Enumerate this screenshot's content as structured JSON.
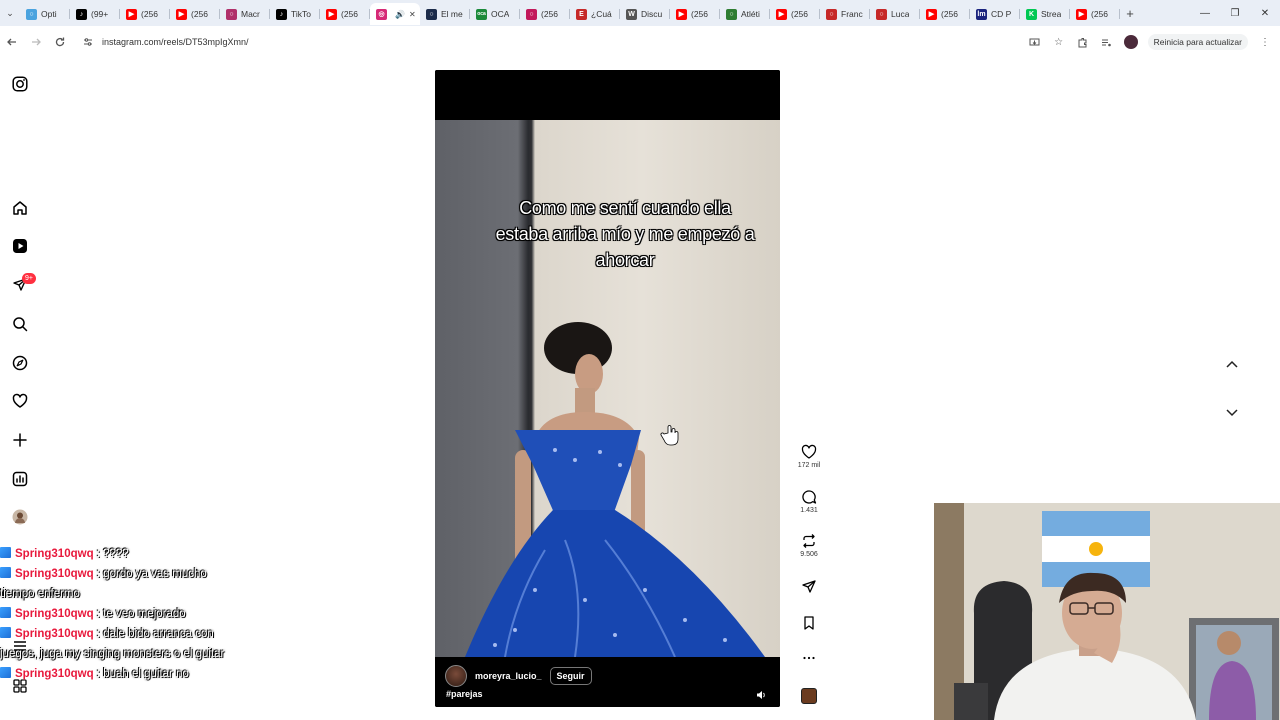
{
  "browser": {
    "tabs": [
      {
        "title": "Opti",
        "color": "#4aa3df",
        "icon": "circle-o"
      },
      {
        "title": "(99+",
        "color": "#000000",
        "icon": "tiktok"
      },
      {
        "title": "(256",
        "color": "#ff0000",
        "icon": "youtube"
      },
      {
        "title": "(256",
        "color": "#ff0000",
        "icon": "youtube"
      },
      {
        "title": "Macr",
        "color": "#b0306a",
        "icon": "circle"
      },
      {
        "title": "TikTo",
        "color": "#000000",
        "icon": "tiktok"
      },
      {
        "title": "(256",
        "color": "#ff0000",
        "icon": "youtube"
      },
      {
        "title": "",
        "color": "#d62976",
        "icon": "instagram",
        "active": true
      },
      {
        "title": "El me",
        "color": "#1c2b4a",
        "icon": "shield"
      },
      {
        "title": "OCA",
        "color": "#1b8a3a",
        "icon": "oca"
      },
      {
        "title": "(256",
        "color": "#c2185b",
        "icon": "circle"
      },
      {
        "title": "¿Cuá",
        "color": "#c62828",
        "icon": "E"
      },
      {
        "title": "Discu",
        "color": "#555555",
        "icon": "W"
      },
      {
        "title": "(256",
        "color": "#ff0000",
        "icon": "youtube"
      },
      {
        "title": "Atléti",
        "color": "#2e7d32",
        "icon": "circle-o"
      },
      {
        "title": "(256",
        "color": "#ff0000",
        "icon": "youtube"
      },
      {
        "title": "Franc",
        "color": "#c62828",
        "icon": "circle"
      },
      {
        "title": "Luca",
        "color": "#c62828",
        "icon": "circle"
      },
      {
        "title": "(256",
        "color": "#ff0000",
        "icon": "youtube"
      },
      {
        "title": "CD P",
        "color": "#1a237e",
        "icon": "lm"
      },
      {
        "title": "Strea",
        "color": "#00c853",
        "icon": "K"
      },
      {
        "title": "(256",
        "color": "#ff0000",
        "icon": "youtube"
      }
    ],
    "url": "instagram.com/reels/DT53mpIgXmn/",
    "update_label": "Reinicia para actualizar"
  },
  "reel": {
    "overlay_text": "Como me sentí cuando ella estaba arriba mío y me empezó a ahorcar",
    "author": "moreyra_lucio_",
    "follow_label": "Seguir",
    "hashtag": "#parejas"
  },
  "actions": {
    "likes": "172 mil",
    "comments": "1.431",
    "reposts": "9.506"
  },
  "sidebar": {
    "notifications_badge": "9+"
  },
  "chat": [
    {
      "user": "Spring310qwq",
      "message": " : ????"
    },
    {
      "user": "Spring310qwq",
      "message": " : gordo ya vas mucho tiempo enfermo"
    },
    {
      "user": "Spring310qwq",
      "message": " : te veo mejorado"
    },
    {
      "user": "Spring310qwq",
      "message": " : dale bido arranca con juegos, juga my singing monsters o el guitar"
    },
    {
      "user": "Spring310qwq",
      "message": " : buah el guitar no"
    }
  ]
}
